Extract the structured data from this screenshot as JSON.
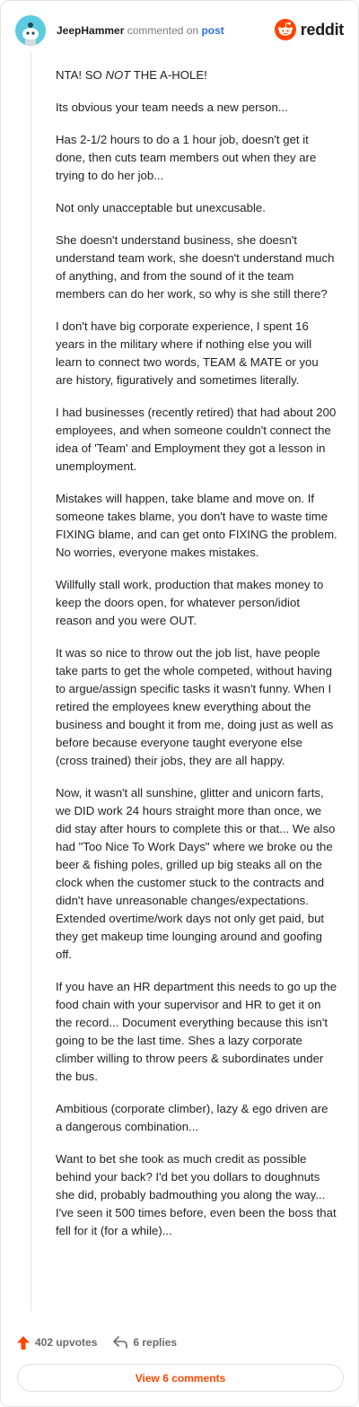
{
  "header": {
    "username": "JeepHammer",
    "action": "commented on",
    "target": "post",
    "brand": "reddit",
    "brand_color": "#ff4500",
    "avatar_icon": "snoo-avatar-icon",
    "logo_icon": "reddit-alien-icon"
  },
  "comment": {
    "title_prefix": "NTA! SO ",
    "title_emphasis": "NOT",
    "title_suffix": " THE A-HOLE!",
    "paragraphs": [
      "Its obvious your team needs a new person...",
      "Has 2-1/2 hours to do a 1 hour job, doesn't get it done, then cuts team members out when they are trying to do her job...",
      "Not only unacceptable but unexcusable.",
      "She doesn't understand business, she doesn't understand team work, she doesn't understand much of anything, and from the sound of it the team members can do her work, so why is she still there?",
      "I don't have big corporate experience, I spent 16 years in the military where if nothing else you will learn to connect two words, TEAM & MATE or you are history, figuratively and sometimes literally.",
      "I had businesses (recently retired) that had about 200 employees, and when someone couldn't connect the idea of 'Team' and Employment they got a lesson in unemployment.",
      "Mistakes will happen, take blame and move on. If someone takes blame, you don't have to waste time FIXING blame, and can get onto FIXING the problem. No worries, everyone makes mistakes.",
      "Willfully stall work, production that makes money to keep the doors open, for whatever person/idiot reason and you were OUT.",
      "It was so nice to throw out the job list, have people take parts to get the whole competed, without having to argue/assign specific tasks it wasn't funny. When I retired the employees knew everything about the business and bought it from me, doing just as well as before because everyone taught everyone else (cross trained) their jobs, they are all happy.",
      "Now, it wasn't all sunshine, glitter and unicorn farts, we DID work 24 hours straight more than once, we did stay after hours to complete this or that... We also had \"Too Nice To Work Days\" where we broke ou the beer & fishing poles, grilled up big steaks all on the clock when the customer stuck to the contracts and didn't have unreasonable changes/expectations. Extended overtime/work days not only get paid, but they get makeup time lounging around and goofing off.",
      "If you have an HR department this needs to go up the food chain with your supervisor and HR to get it on the record... Document everything because this isn't going to be the last time. Shes a lazy corporate climber willing to throw peers & subordinates under the bus.",
      "Ambitious (corporate climber), lazy & ego driven are a dangerous combination...",
      "Want to bet she took as much credit as possible behind your back? I'd bet you dollars to doughnuts she did, probably badmouthing you along the way... I've seen it 500 times before, even been the boss that fell for it (for a while)..."
    ]
  },
  "footer": {
    "upvotes": "402 upvotes",
    "replies": "6 replies",
    "view_button": "View 6 comments",
    "upvote_icon": "upvote-arrow-icon",
    "reply_icon": "reply-arrow-icon"
  }
}
